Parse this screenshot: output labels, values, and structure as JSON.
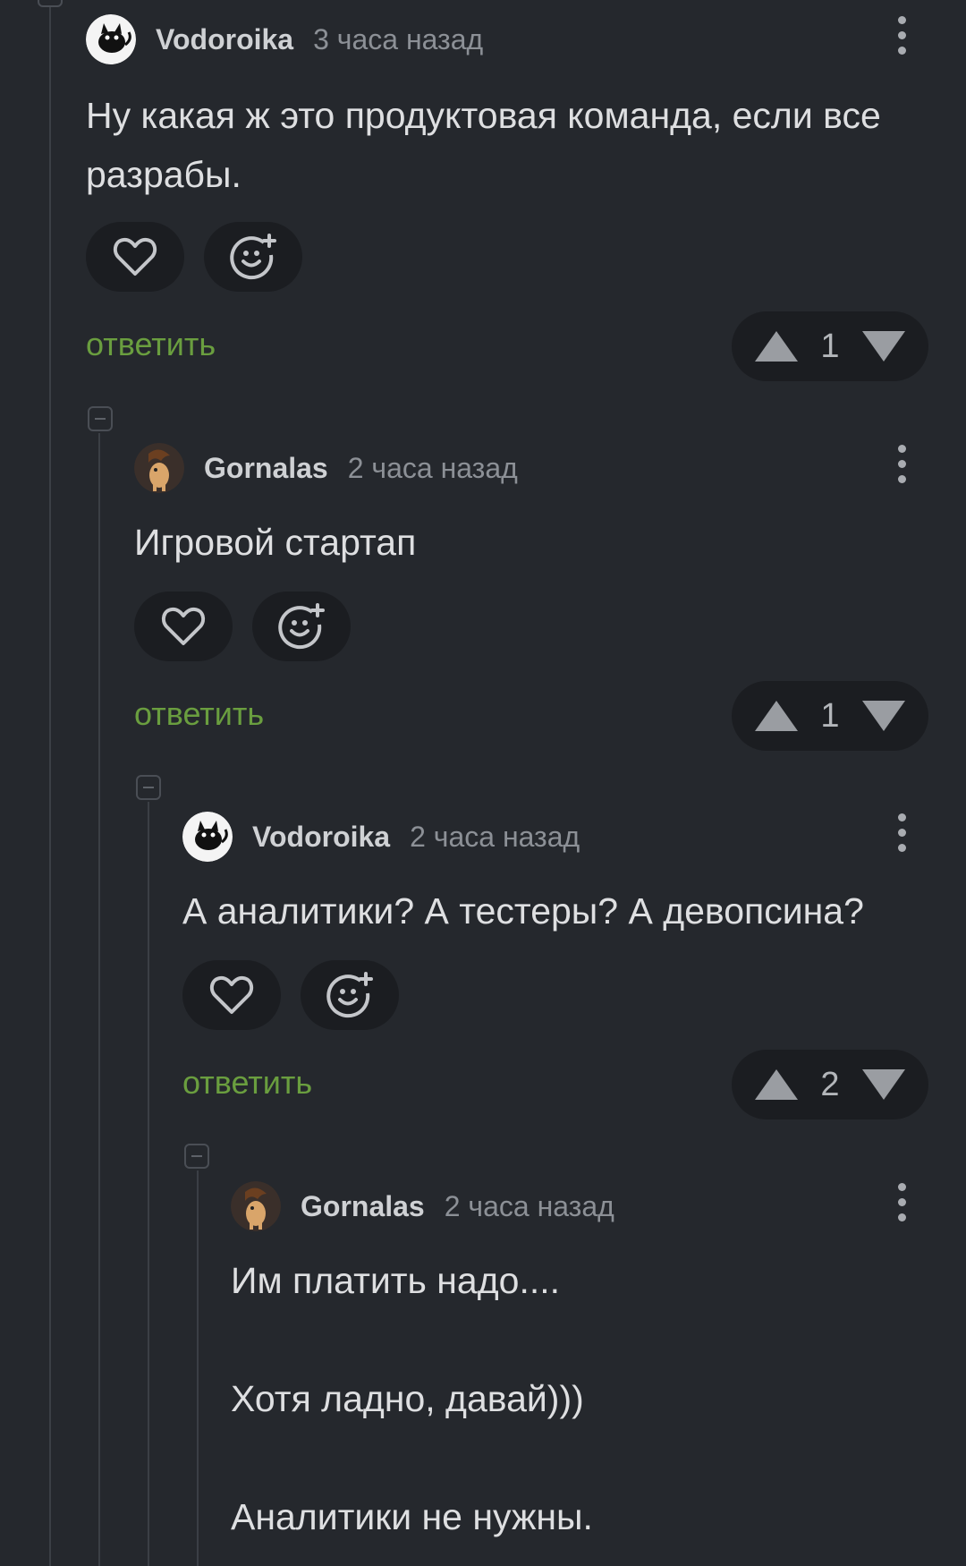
{
  "comments": [
    {
      "author": "Vodoroika",
      "time": "3 часа назад",
      "text": "Ну какая ж это продуктовая команда, если все разрабы.",
      "reply_label": "ответить",
      "rating": "1",
      "avatar": "cat-avatar-icon"
    },
    {
      "author": "Gornalas",
      "time": "2 часа назад",
      "text": "Игровой стартап",
      "reply_label": "ответить",
      "rating": "1",
      "avatar": "pony-avatar-icon"
    },
    {
      "author": "Vodoroika",
      "time": "2 часа назад",
      "text": "А аналитики? А тестеры? А девопсина?",
      "reply_label": "ответить",
      "rating": "2",
      "avatar": "cat-avatar-icon"
    },
    {
      "author": "Gornalas",
      "time": "2 часа назад",
      "text": "Им платить надо....\n\nХотя ладно, давай)))\n\nАналитики не нужны.",
      "avatar": "pony-avatar-icon"
    }
  ],
  "colors": {
    "background": "#25282d",
    "pill": "#1b1d21",
    "reply": "#6a9e3f",
    "thread_line": "#3b3f45"
  },
  "icons": {
    "like": "heart-icon",
    "react": "emoji-add-icon",
    "upvote": "triangle-up-icon",
    "downvote": "triangle-down-icon",
    "menu": "more-vertical-icon",
    "collapse": "collapse-minus-icon"
  }
}
